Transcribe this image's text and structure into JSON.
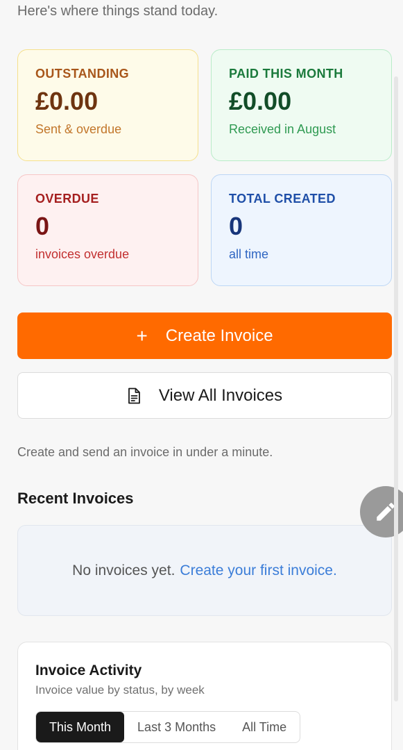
{
  "header": {
    "subtitle": "Here's where things stand today."
  },
  "stats": {
    "outstanding": {
      "label": "OUTSTANDING",
      "value": "£0.00",
      "sub": "Sent & overdue"
    },
    "paid": {
      "label": "PAID THIS MONTH",
      "value": "£0.00",
      "sub": "Received in August"
    },
    "overdue": {
      "label": "OVERDUE",
      "value": "0",
      "sub": "invoices overdue"
    },
    "total": {
      "label": "TOTAL CREATED",
      "value": "0",
      "sub": "all time"
    }
  },
  "actions": {
    "create_label": "Create Invoice",
    "create_icon": "plus-icon",
    "view_all_label": "View All Invoices",
    "view_all_icon": "document-icon",
    "hint": "Create and send an invoice in under a minute."
  },
  "recent": {
    "title": "Recent Invoices",
    "empty_text": "No invoices yet.",
    "empty_link": "Create your first invoice."
  },
  "activity": {
    "title": "Invoice Activity",
    "subtitle": "Invoice value by status, by week",
    "tabs": [
      {
        "label": "This Month",
        "active": true
      },
      {
        "label": "Last 3 Months",
        "active": false
      },
      {
        "label": "All Time",
        "active": false
      }
    ]
  },
  "fab": {
    "icon": "pencil-icon"
  },
  "colors": {
    "primary": "#ff6a00",
    "link": "#3b7dd8"
  }
}
